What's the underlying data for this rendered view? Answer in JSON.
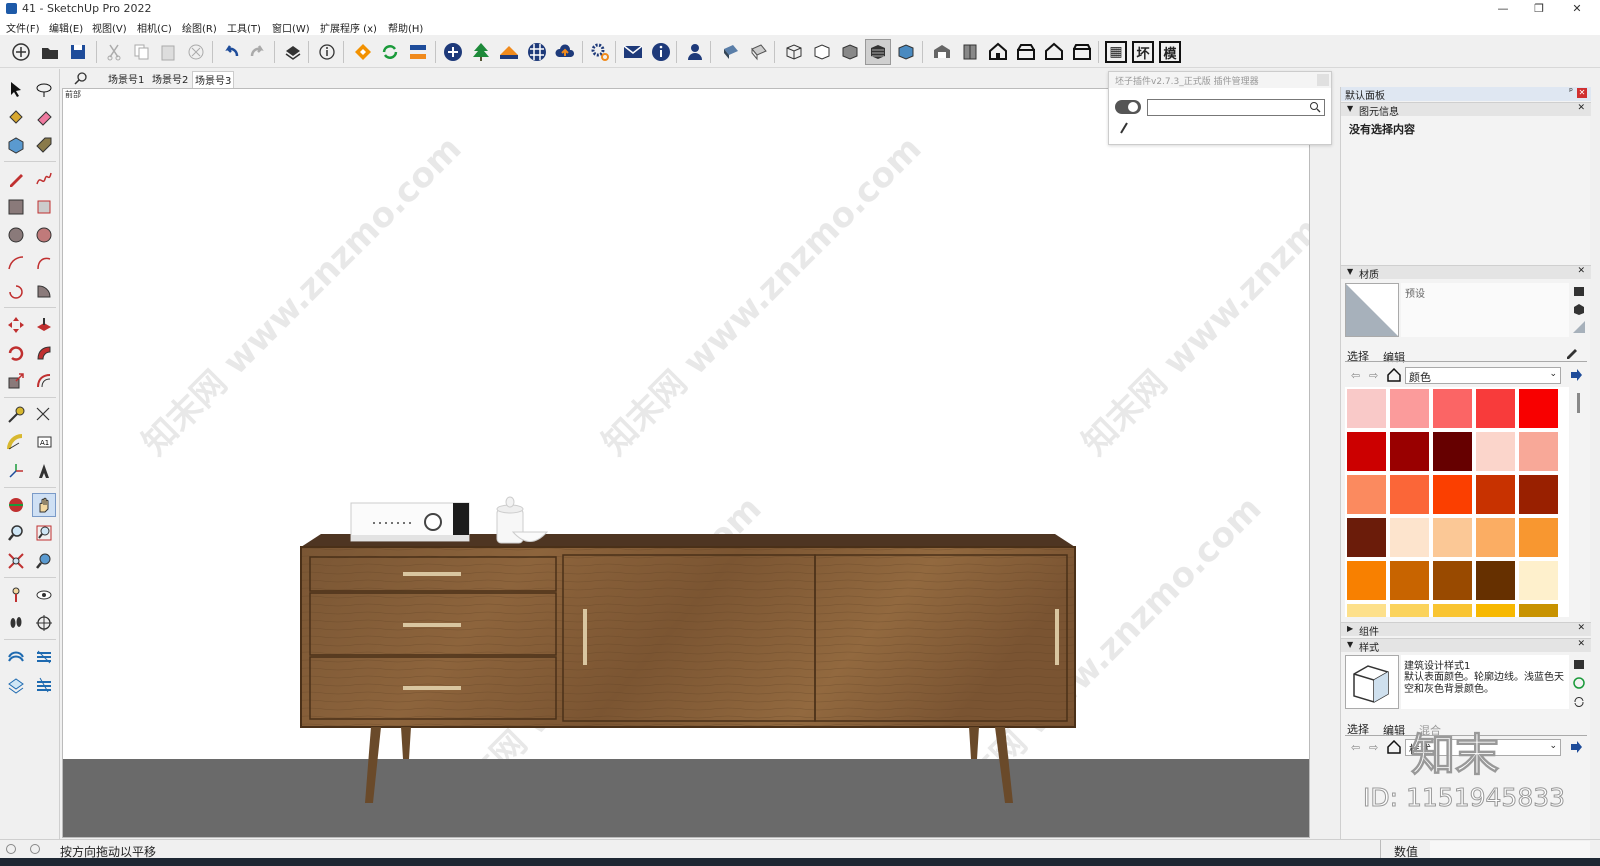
{
  "window": {
    "title": "41 - SketchUp Pro 2022",
    "minimize": "—",
    "restore": "❐",
    "close": "✕"
  },
  "menu": [
    "文件(F)",
    "编辑(E)",
    "视图(V)",
    "相机(C)",
    "绘图(R)",
    "工具(T)",
    "窗口(W)",
    "扩展程序 (x)",
    "帮助(H)"
  ],
  "toolbar_text": {
    "btn1": "坏",
    "btn2": "模"
  },
  "scenes": {
    "search_icon": "magnifier-icon",
    "tabs": [
      "场景号1",
      "场景号2",
      "场景号3"
    ],
    "view_label": "前部"
  },
  "plugin_manager": {
    "title": "坯子插件v2.7.3_正式版 插件管理器",
    "search_value": ""
  },
  "panel": {
    "title": "默认面板",
    "pin": "ᵖ",
    "entity_info": {
      "header": "图元信息",
      "text": "没有选择内容"
    },
    "materials": {
      "header": "材质",
      "preset": "预设",
      "tab_select": "选择",
      "tab_edit": "编辑",
      "library": "颜色"
    },
    "components": {
      "header": "组件"
    },
    "styles": {
      "header": "样式",
      "name": "建筑设计样式1",
      "desc": "默认表面颜色。轮廓边线。浅蓝色天空和灰色背景颜色。",
      "tab_select": "选择",
      "tab_edit": "编辑",
      "tab_mix": "混合",
      "library": "样式"
    }
  },
  "swatches": [
    "#f9c9c8",
    "#fb9b9b",
    "#fb6565",
    "#f83b3b",
    "#f80000",
    "#cc0000",
    "#990000",
    "#660000",
    "#fbd5cb",
    "#f8a898",
    "#fb8a5f",
    "#fb6638",
    "#fb3f00",
    "#c83200",
    "#992000",
    "#6b1c0a",
    "#fde4cd",
    "#fbc896",
    "#fbad63",
    "#f89730",
    "#f88000",
    "#c86400",
    "#994a00",
    "#663000",
    "#fef0cc",
    "#fde08b",
    "#fbd35c",
    "#f9c431",
    "#f7b800",
    "#c89200"
  ],
  "status": {
    "hint": "按方向拖动以平移",
    "value_label": "数值"
  },
  "watermark": {
    "brand": "知末",
    "id": "ID: 1151945833",
    "site": "知末网 www.znzmo.com"
  }
}
